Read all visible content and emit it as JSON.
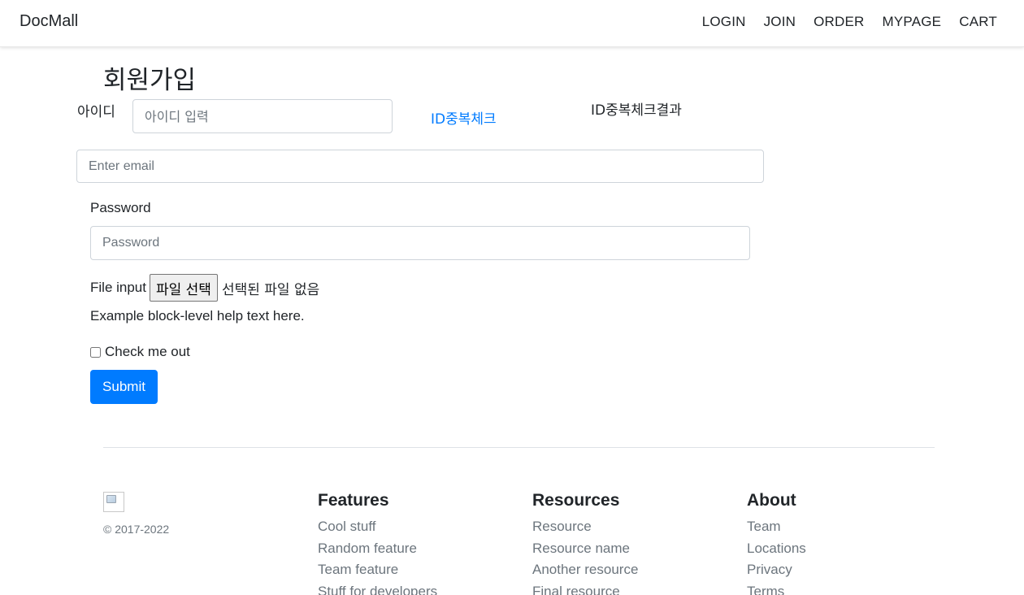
{
  "navbar": {
    "brand": "DocMall",
    "links": [
      "LOGIN",
      "JOIN",
      "ORDER",
      "MYPAGE",
      "CART"
    ]
  },
  "form": {
    "title": "회원가입",
    "id_label": "아이디",
    "id_placeholder": "아이디 입력",
    "dup_check_link": "ID중복체크",
    "dup_check_result": "ID중복체크결과",
    "email_placeholder": "Enter email",
    "password_label": "Password",
    "password_placeholder": "Password",
    "file_label": "File input",
    "file_button": "파일 선택",
    "file_status": "선택된 파일 없음",
    "help_text": "Example block-level help text here.",
    "checkbox_label": "Check me out",
    "checkbox_checked": false,
    "submit_label": "Submit"
  },
  "footer": {
    "copyright": "© 2017-2022",
    "columns": [
      {
        "title": "Features",
        "items": [
          "Cool stuff",
          "Random feature",
          "Team feature",
          "Stuff for developers"
        ]
      },
      {
        "title": "Resources",
        "items": [
          "Resource",
          "Resource name",
          "Another resource",
          "Final resource"
        ]
      },
      {
        "title": "About",
        "items": [
          "Team",
          "Locations",
          "Privacy",
          "Terms"
        ]
      }
    ]
  },
  "colors": {
    "primary": "#007bff",
    "text": "#212529",
    "muted": "#6c757d",
    "border": "#ced4da"
  }
}
